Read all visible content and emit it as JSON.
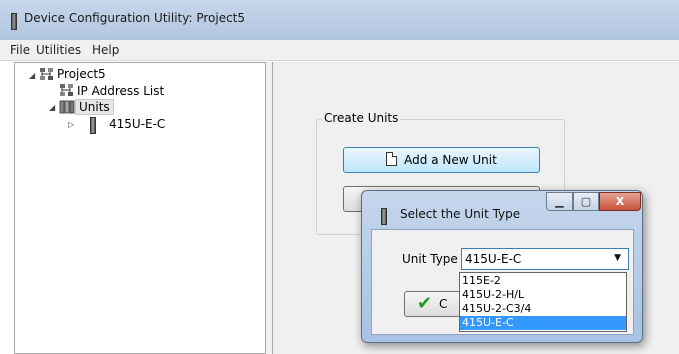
{
  "window": {
    "title": "Device Configuration Utility: Project5"
  },
  "menu": {
    "items": [
      "File",
      "Utilities",
      "Help"
    ]
  },
  "tree": {
    "project": {
      "label": "Project5",
      "toggle": "◢"
    },
    "ip_list": {
      "label": "IP Address List"
    },
    "units": {
      "label": "Units",
      "toggle": "◢"
    },
    "unit_node": {
      "label": "415U-E-C",
      "toggle": "▷"
    }
  },
  "create_units": {
    "legend": "Create Units",
    "add_button": "Add a New Unit"
  },
  "dialog": {
    "title": "Select the Unit Type",
    "min_glyph": "▁",
    "max_glyph": "▢",
    "close_glyph": "X",
    "unit_type_label": "Unit Type",
    "selected": "415U-E-C",
    "options": [
      "115E-2",
      "415U-2-H/L",
      "415U-2-C3/4",
      "415U-E-C"
    ],
    "ok_partial": "C"
  },
  "icons": {
    "dropdown_arrow": "▼",
    "checkmark": "✔"
  },
  "colors": {
    "titlebar": "#c6d6ea",
    "selection": "#3399ff",
    "close_button": "#c7543c",
    "checkmark": "#1f9a1f"
  }
}
